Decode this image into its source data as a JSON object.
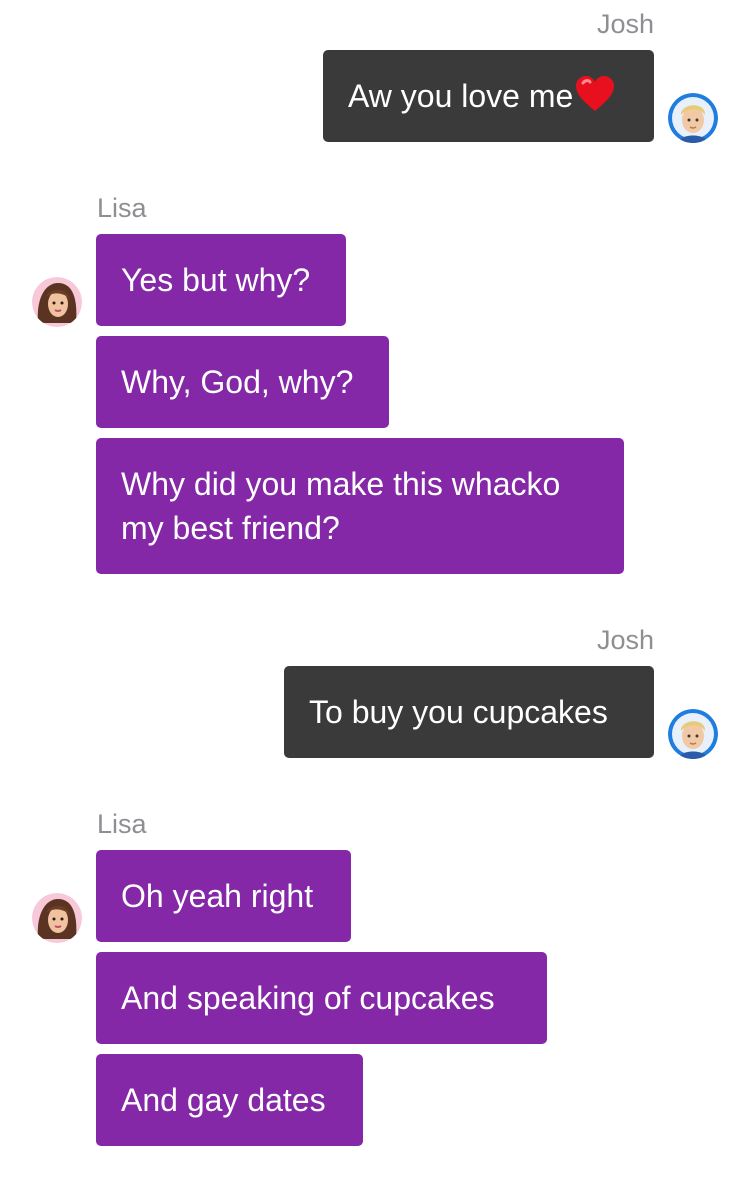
{
  "messages": [
    {
      "sender": "Josh",
      "text": "Aw you love me",
      "emoji": "red-heart"
    },
    {
      "sender": "Lisa",
      "texts": [
        "Yes but why?",
        "Why, God, why?",
        "Why did you make this whacko my best friend?"
      ]
    },
    {
      "sender": "Josh",
      "text": "To buy you cupcakes"
    },
    {
      "sender": "Lisa",
      "texts": [
        "Oh yeah right",
        "And speaking of cupcakes",
        "And gay dates"
      ]
    }
  ],
  "colors": {
    "outgoing_bubble": "#3a3a3a",
    "incoming_bubble": "#8428a8",
    "sender_name": "#8e8e93",
    "background": "#ffffff"
  },
  "icons": {
    "josh_avatar": "josh-avatar-icon",
    "lisa_avatar": "lisa-avatar-icon",
    "heart": "red-heart-icon"
  }
}
